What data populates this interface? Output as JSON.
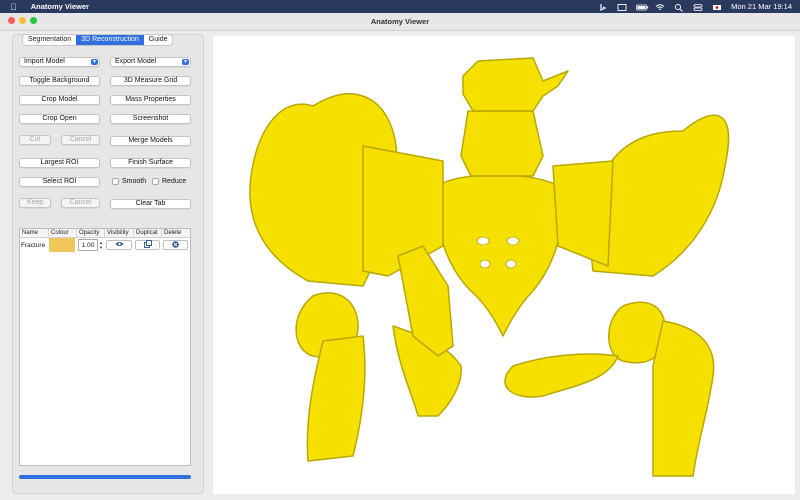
{
  "menubar": {
    "app_name": "Anatomy Viewer",
    "datetime": "Mon 21 Mar  19:14",
    "icons": [
      "apple-icon",
      "bing-icon",
      "display-icon",
      "battery-icon",
      "wifi-icon",
      "search-icon",
      "control-center-icon",
      "flag-icon"
    ]
  },
  "window": {
    "title": "Anatomy Viewer"
  },
  "tabs": [
    {
      "label": "Segmentation",
      "active": false
    },
    {
      "label": "3D Reconstruction",
      "active": true
    },
    {
      "label": "Guide",
      "active": false
    }
  ],
  "buttons": {
    "import_model": "Import Model",
    "export_model": "Export Model",
    "toggle_background": "Toggle Background",
    "measure_grid": "3D Measure Grid",
    "crop_model": "Crop Model",
    "mass_properties": "Mass Properties",
    "crop_open": "Crop Open",
    "screenshot": "Screenshot",
    "cut": "Cut",
    "cancel_1": "Cancel",
    "merge_models": "Merge Models",
    "largest_roi": "Largest ROI",
    "finish_surface": "Finish Surface",
    "select_roi": "Select ROI",
    "keep": "Keep",
    "cancel_2": "Cancel",
    "clear_tab": "Clear Tab"
  },
  "checkboxes": {
    "smooth": "Smooth",
    "reduce": "Reduce"
  },
  "table": {
    "columns": [
      "Name",
      "Colour",
      "Opacity",
      "Visibility",
      "Duplicat",
      "Delete"
    ],
    "rows": [
      {
        "name": "Fracture",
        "colour": "#f0c85a",
        "opacity": "1.00"
      }
    ]
  },
  "progress": {
    "value": 1.0
  },
  "colors": {
    "accent": "#2f6fdf",
    "model": "#f5e000",
    "model_dark": "#b8a800"
  }
}
